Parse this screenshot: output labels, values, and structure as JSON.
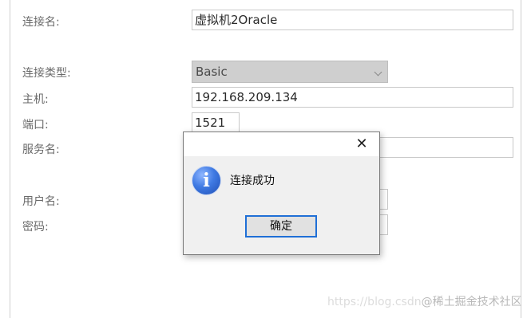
{
  "form": {
    "connection_name_label": "连接名:",
    "connection_name_value": "虚拟机2Oracle",
    "connection_type_label": "连接类型:",
    "connection_type_value": "Basic",
    "host_label": "主机:",
    "host_value": "192.168.209.134",
    "port_label": "端口:",
    "port_value": "1521",
    "service_name_label": "服务名:",
    "service_name_value": "",
    "username_label": "用户名:",
    "username_value": "",
    "password_label": "密码:",
    "password_value": ""
  },
  "dialog": {
    "close_glyph": "✕",
    "info_glyph": "i",
    "message": "连接成功",
    "ok_label": "确定"
  },
  "watermark": {
    "url_text": "https://blog.csdn",
    "brand_text": "@稀土掘金技术社区"
  }
}
